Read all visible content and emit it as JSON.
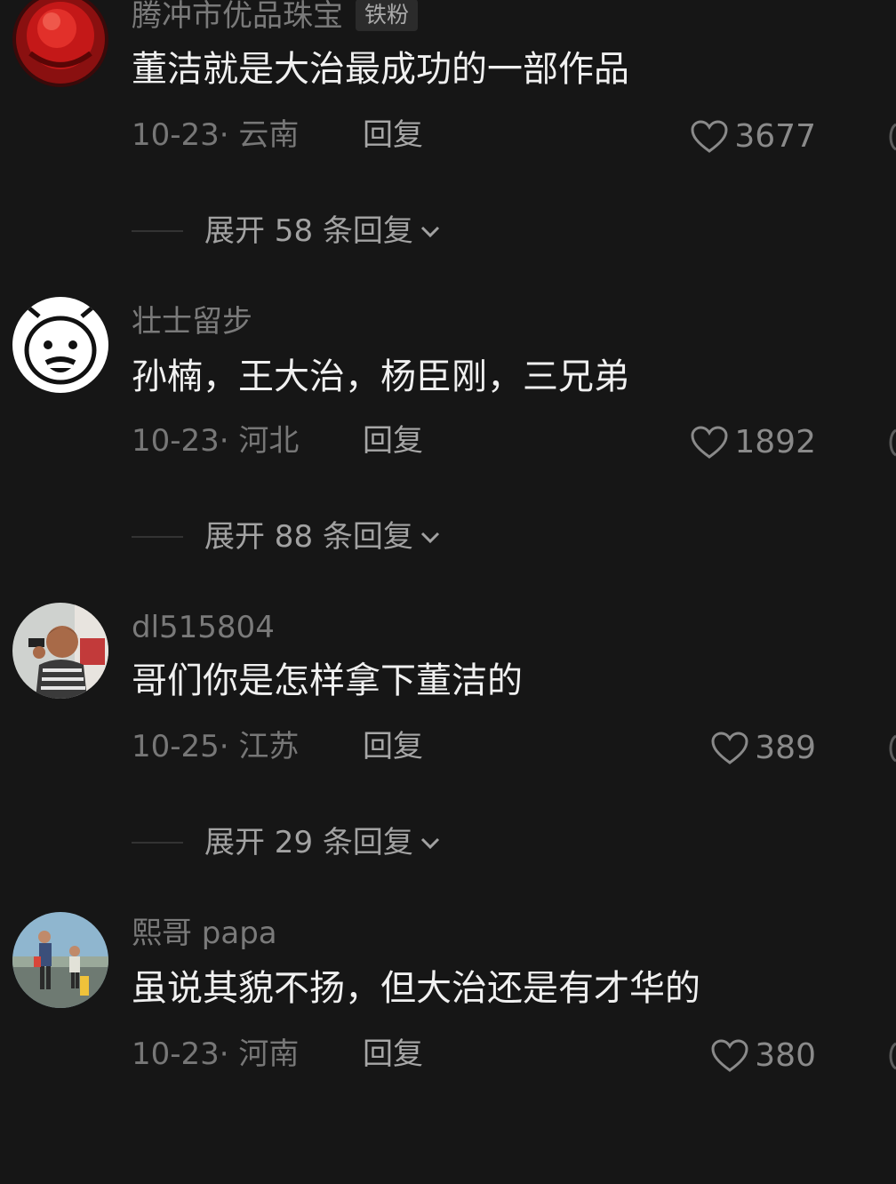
{
  "comments": [
    {
      "username": "腾冲市优品珠宝",
      "badge": "铁粉",
      "text": "董洁就是大治最成功的一部作品",
      "meta": "10-23· 云南",
      "reply_label": "回复",
      "likes": "3677",
      "expand_label": "展开 58 条回复",
      "avatar_icon": "red-circle-avatar"
    },
    {
      "username": "壮士留步",
      "text": "孙楠，王大治，杨臣刚，三兄弟",
      "meta": "10-23· 河北",
      "reply_label": "回复",
      "likes": "1892",
      "expand_label": "展开 88 条回复",
      "avatar_icon": "cartoon-face-avatar"
    },
    {
      "username": "dl515804",
      "text": "哥们你是怎样拿下董洁的",
      "meta": "10-25· 江苏",
      "reply_label": "回复",
      "likes": "389",
      "expand_label": "展开 29 条回复",
      "avatar_icon": "child-photo-avatar"
    },
    {
      "username": "熙哥 papa",
      "text": "虽说其貌不扬，但大治还是有才华的",
      "meta": "10-23· 河南",
      "reply_label": "回复",
      "likes": "380",
      "avatar_icon": "family-photo-avatar"
    }
  ],
  "colors": {
    "background": "#161616",
    "username": "#7a7a7a",
    "content": "#f0f0f0",
    "meta": "#777777"
  }
}
